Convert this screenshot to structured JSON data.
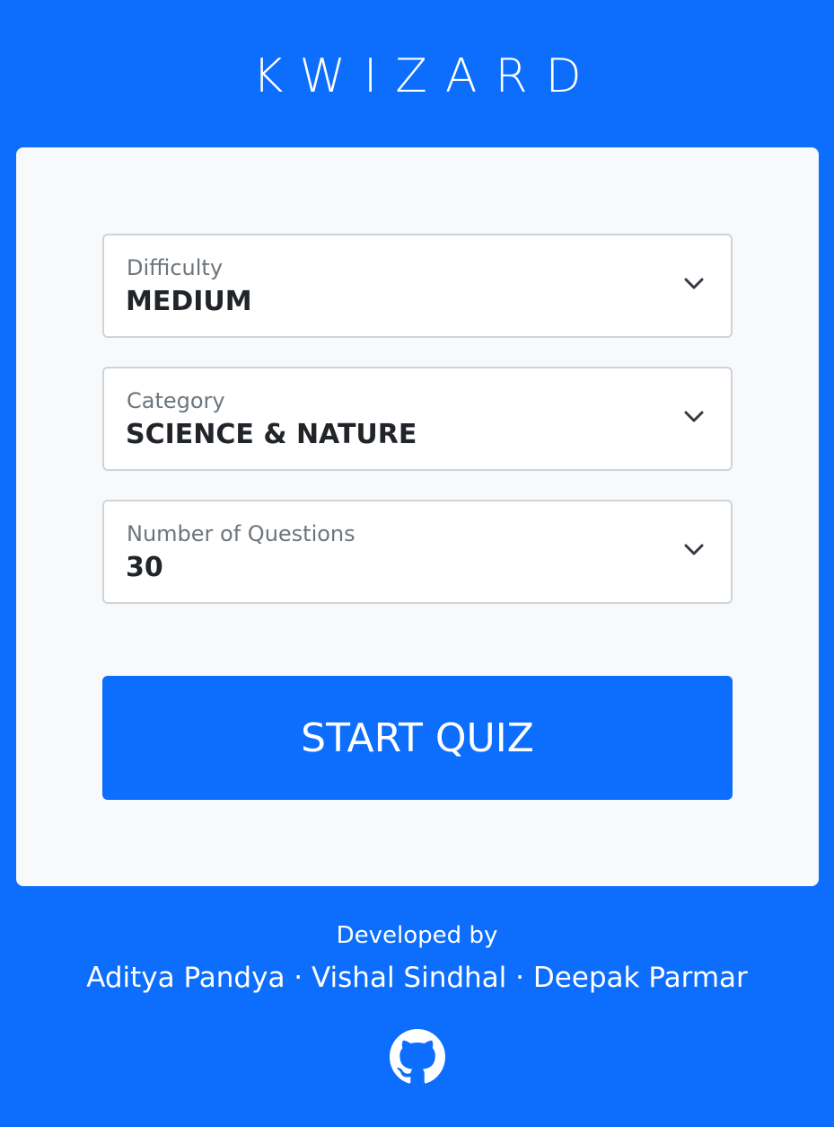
{
  "header": {
    "title": "KWIZARD"
  },
  "form": {
    "difficulty": {
      "label": "Difficulty",
      "value": "MEDIUM"
    },
    "category": {
      "label": "Category",
      "value": "SCIENCE & NATURE"
    },
    "questions": {
      "label": "Number of Questions",
      "value": "30"
    },
    "start_label": "START QUIZ"
  },
  "footer": {
    "developed_by": "Developed by",
    "authors": "Aditya Pandya · Vishal Sindhal · Deepak Parmar",
    "github_icon": "github-icon"
  },
  "colors": {
    "background": "#0d6efd",
    "card": "#f8f9fa",
    "button": "#0d6efd"
  }
}
